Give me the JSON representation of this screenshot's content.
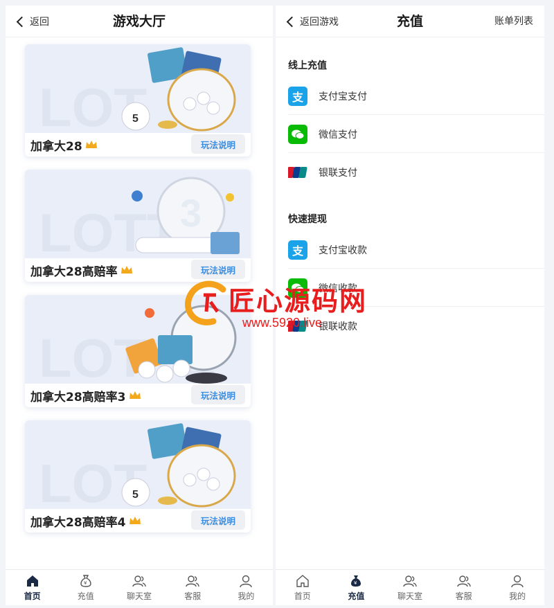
{
  "left": {
    "nav": {
      "back_label": "返回",
      "title": "游戏大厅"
    },
    "games": [
      {
        "name": "加拿大28",
        "rules_label": "玩法说明"
      },
      {
        "name": "加拿大28高赔率",
        "rules_label": "玩法说明"
      },
      {
        "name": "加拿大28高赔率3",
        "rules_label": "玩法说明"
      },
      {
        "name": "加拿大28高赔率4",
        "rules_label": "玩法说明"
      }
    ],
    "tabs": [
      {
        "label": "首页",
        "icon": "home-icon",
        "active": true
      },
      {
        "label": "充值",
        "icon": "money-bag-icon",
        "active": false
      },
      {
        "label": "聊天室",
        "icon": "users-icon",
        "active": false
      },
      {
        "label": "客服",
        "icon": "users-icon",
        "active": false
      },
      {
        "label": "我的",
        "icon": "user-icon",
        "active": false
      }
    ]
  },
  "right": {
    "nav": {
      "back_label": "返回游戏",
      "title": "充值",
      "right_label": "账单列表"
    },
    "online_section": "线上充值",
    "online_methods": [
      {
        "label": "支付宝支付",
        "icon": "alipay-icon"
      },
      {
        "label": "微信支付",
        "icon": "wechat-icon"
      },
      {
        "label": "银联支付",
        "icon": "unionpay-icon"
      }
    ],
    "withdraw_section": "快速提现",
    "withdraw_methods": [
      {
        "label": "支付宝收款",
        "icon": "alipay-icon"
      },
      {
        "label": "微信收款",
        "icon": "wechat-icon"
      },
      {
        "label": "银联收款",
        "icon": "unionpay-icon"
      }
    ],
    "tabs": [
      {
        "label": "首页",
        "icon": "home-icon",
        "active": false
      },
      {
        "label": "充值",
        "icon": "money-bag-icon",
        "active": true
      },
      {
        "label": "聊天室",
        "icon": "users-icon",
        "active": false
      },
      {
        "label": "客服",
        "icon": "users-icon",
        "active": false
      },
      {
        "label": "我的",
        "icon": "user-icon",
        "active": false
      }
    ]
  },
  "watermark": {
    "title": "匠心源码网",
    "url": "www.5920.live"
  },
  "colors": {
    "accent": "#3b8de0",
    "alipay": "#1aa3e8",
    "wechat": "#09bb07",
    "unionpay": "#d7182a"
  }
}
